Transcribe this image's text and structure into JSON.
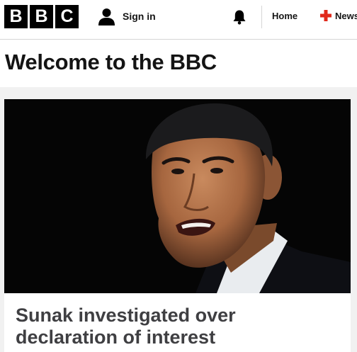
{
  "header": {
    "logo_letters": [
      "B",
      "B",
      "C"
    ],
    "sign_in_label": "Sign in",
    "icons": {
      "account": "person-icon",
      "notifications": "bell-icon",
      "news": "news-icon"
    },
    "nav": {
      "home_label": "Home",
      "news_label": "News"
    }
  },
  "page": {
    "title": "Welcome to the BBC"
  },
  "top_story": {
    "headline": "Sunak investigated over declaration of interest",
    "image_desc": "photo"
  },
  "colors": {
    "brand_black": "#000000",
    "news_red": "#e0291b",
    "headline_grey": "#3f3f42",
    "band_grey": "#f1f1f1"
  }
}
